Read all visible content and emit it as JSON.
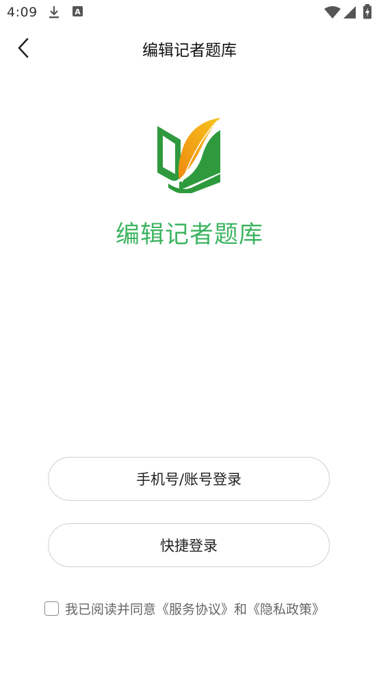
{
  "status_bar": {
    "time": "4:09",
    "icons": [
      "download-icon",
      "a-notification-icon",
      "wifi-icon",
      "signal-icon",
      "battery-charging-icon"
    ]
  },
  "nav": {
    "title": "编辑记者题库",
    "back_icon": "chevron-left-icon"
  },
  "brand": {
    "app_name": "编辑记者题库",
    "app_name_color": "#3db461",
    "logo_colors": {
      "green": "#2e9a3d",
      "orange": "#f08a12",
      "yellow": "#f6c41c"
    }
  },
  "buttons": {
    "phone_login": "手机号/账号登录",
    "quick_login": "快捷登录"
  },
  "agreement": {
    "checked": false,
    "prefix": "我已阅读并同意",
    "service_link": "《服务协议》",
    "joiner": "和",
    "privacy_link": "《隐私政策》"
  }
}
